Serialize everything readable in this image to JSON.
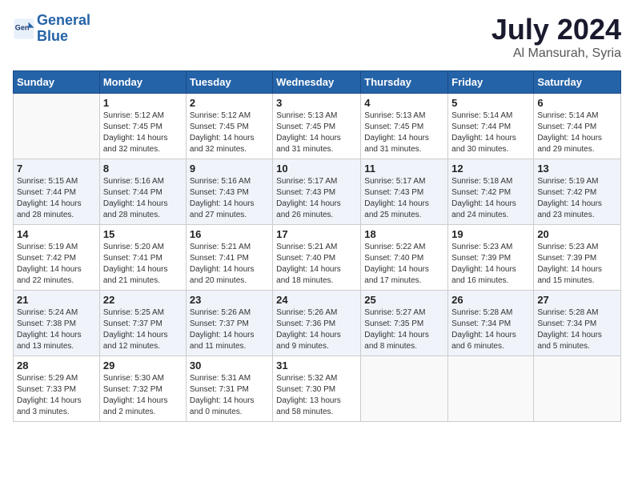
{
  "logo": {
    "line1": "General",
    "line2": "Blue"
  },
  "title": "July 2024",
  "subtitle": "Al Mansurah, Syria",
  "days_of_week": [
    "Sunday",
    "Monday",
    "Tuesday",
    "Wednesday",
    "Thursday",
    "Friday",
    "Saturday"
  ],
  "weeks": [
    [
      {
        "num": "",
        "info": ""
      },
      {
        "num": "1",
        "info": "Sunrise: 5:12 AM\nSunset: 7:45 PM\nDaylight: 14 hours\nand 32 minutes."
      },
      {
        "num": "2",
        "info": "Sunrise: 5:12 AM\nSunset: 7:45 PM\nDaylight: 14 hours\nand 32 minutes."
      },
      {
        "num": "3",
        "info": "Sunrise: 5:13 AM\nSunset: 7:45 PM\nDaylight: 14 hours\nand 31 minutes."
      },
      {
        "num": "4",
        "info": "Sunrise: 5:13 AM\nSunset: 7:45 PM\nDaylight: 14 hours\nand 31 minutes."
      },
      {
        "num": "5",
        "info": "Sunrise: 5:14 AM\nSunset: 7:44 PM\nDaylight: 14 hours\nand 30 minutes."
      },
      {
        "num": "6",
        "info": "Sunrise: 5:14 AM\nSunset: 7:44 PM\nDaylight: 14 hours\nand 29 minutes."
      }
    ],
    [
      {
        "num": "7",
        "info": "Sunrise: 5:15 AM\nSunset: 7:44 PM\nDaylight: 14 hours\nand 28 minutes."
      },
      {
        "num": "8",
        "info": "Sunrise: 5:16 AM\nSunset: 7:44 PM\nDaylight: 14 hours\nand 28 minutes."
      },
      {
        "num": "9",
        "info": "Sunrise: 5:16 AM\nSunset: 7:43 PM\nDaylight: 14 hours\nand 27 minutes."
      },
      {
        "num": "10",
        "info": "Sunrise: 5:17 AM\nSunset: 7:43 PM\nDaylight: 14 hours\nand 26 minutes."
      },
      {
        "num": "11",
        "info": "Sunrise: 5:17 AM\nSunset: 7:43 PM\nDaylight: 14 hours\nand 25 minutes."
      },
      {
        "num": "12",
        "info": "Sunrise: 5:18 AM\nSunset: 7:42 PM\nDaylight: 14 hours\nand 24 minutes."
      },
      {
        "num": "13",
        "info": "Sunrise: 5:19 AM\nSunset: 7:42 PM\nDaylight: 14 hours\nand 23 minutes."
      }
    ],
    [
      {
        "num": "14",
        "info": "Sunrise: 5:19 AM\nSunset: 7:42 PM\nDaylight: 14 hours\nand 22 minutes."
      },
      {
        "num": "15",
        "info": "Sunrise: 5:20 AM\nSunset: 7:41 PM\nDaylight: 14 hours\nand 21 minutes."
      },
      {
        "num": "16",
        "info": "Sunrise: 5:21 AM\nSunset: 7:41 PM\nDaylight: 14 hours\nand 20 minutes."
      },
      {
        "num": "17",
        "info": "Sunrise: 5:21 AM\nSunset: 7:40 PM\nDaylight: 14 hours\nand 18 minutes."
      },
      {
        "num": "18",
        "info": "Sunrise: 5:22 AM\nSunset: 7:40 PM\nDaylight: 14 hours\nand 17 minutes."
      },
      {
        "num": "19",
        "info": "Sunrise: 5:23 AM\nSunset: 7:39 PM\nDaylight: 14 hours\nand 16 minutes."
      },
      {
        "num": "20",
        "info": "Sunrise: 5:23 AM\nSunset: 7:39 PM\nDaylight: 14 hours\nand 15 minutes."
      }
    ],
    [
      {
        "num": "21",
        "info": "Sunrise: 5:24 AM\nSunset: 7:38 PM\nDaylight: 14 hours\nand 13 minutes."
      },
      {
        "num": "22",
        "info": "Sunrise: 5:25 AM\nSunset: 7:37 PM\nDaylight: 14 hours\nand 12 minutes."
      },
      {
        "num": "23",
        "info": "Sunrise: 5:26 AM\nSunset: 7:37 PM\nDaylight: 14 hours\nand 11 minutes."
      },
      {
        "num": "24",
        "info": "Sunrise: 5:26 AM\nSunset: 7:36 PM\nDaylight: 14 hours\nand 9 minutes."
      },
      {
        "num": "25",
        "info": "Sunrise: 5:27 AM\nSunset: 7:35 PM\nDaylight: 14 hours\nand 8 minutes."
      },
      {
        "num": "26",
        "info": "Sunrise: 5:28 AM\nSunset: 7:34 PM\nDaylight: 14 hours\nand 6 minutes."
      },
      {
        "num": "27",
        "info": "Sunrise: 5:28 AM\nSunset: 7:34 PM\nDaylight: 14 hours\nand 5 minutes."
      }
    ],
    [
      {
        "num": "28",
        "info": "Sunrise: 5:29 AM\nSunset: 7:33 PM\nDaylight: 14 hours\nand 3 minutes."
      },
      {
        "num": "29",
        "info": "Sunrise: 5:30 AM\nSunset: 7:32 PM\nDaylight: 14 hours\nand 2 minutes."
      },
      {
        "num": "30",
        "info": "Sunrise: 5:31 AM\nSunset: 7:31 PM\nDaylight: 14 hours\nand 0 minutes."
      },
      {
        "num": "31",
        "info": "Sunrise: 5:32 AM\nSunset: 7:30 PM\nDaylight: 13 hours\nand 58 minutes."
      },
      {
        "num": "",
        "info": ""
      },
      {
        "num": "",
        "info": ""
      },
      {
        "num": "",
        "info": ""
      }
    ]
  ]
}
